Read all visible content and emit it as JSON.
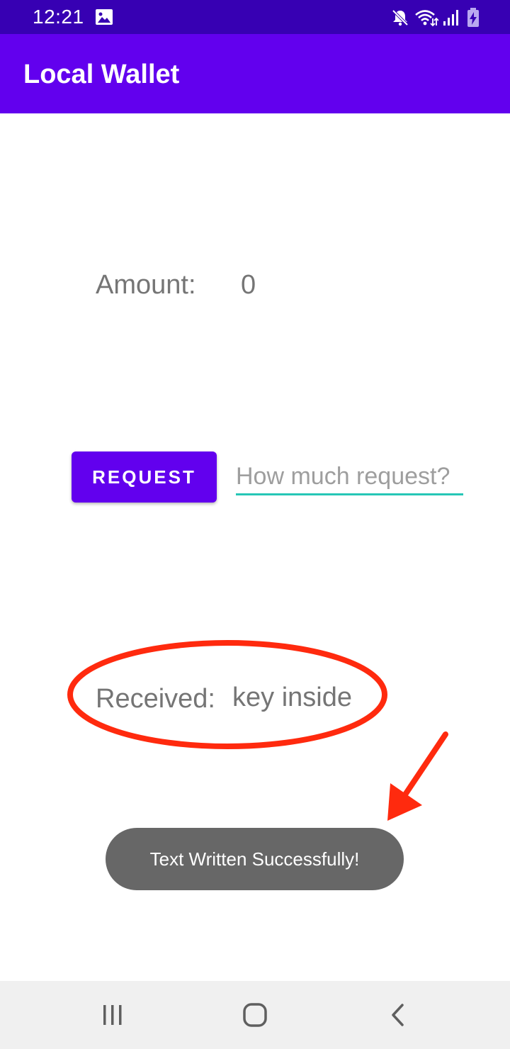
{
  "status_bar": {
    "time": "12:21",
    "icons": [
      "image-icon",
      "mute-icon",
      "wifi-icon",
      "signal-icon",
      "battery-charging-icon"
    ],
    "background": "#3700b3"
  },
  "app_bar": {
    "title": "Local Wallet",
    "background": "#6200ee"
  },
  "main": {
    "amount_label": "Amount:",
    "amount_value": "0",
    "request_button_label": "REQUEST",
    "request_input_placeholder": "How much request?",
    "request_input_value": "",
    "received_label": "Received:",
    "received_value": "key inside"
  },
  "toast": {
    "message": "Text Written Successfully!"
  },
  "annotations": {
    "highlight_color": "#ff2a0e",
    "shapes": [
      "ellipse-around-received",
      "arrow-to-toast"
    ]
  },
  "nav_bar": {
    "buttons": [
      "recent-apps-icon",
      "home-icon",
      "back-icon"
    ]
  },
  "colors": {
    "accent": "#6200ee",
    "input_underline": "#26c6b6",
    "text_secondary": "#757575",
    "toast_bg": "#676767"
  }
}
